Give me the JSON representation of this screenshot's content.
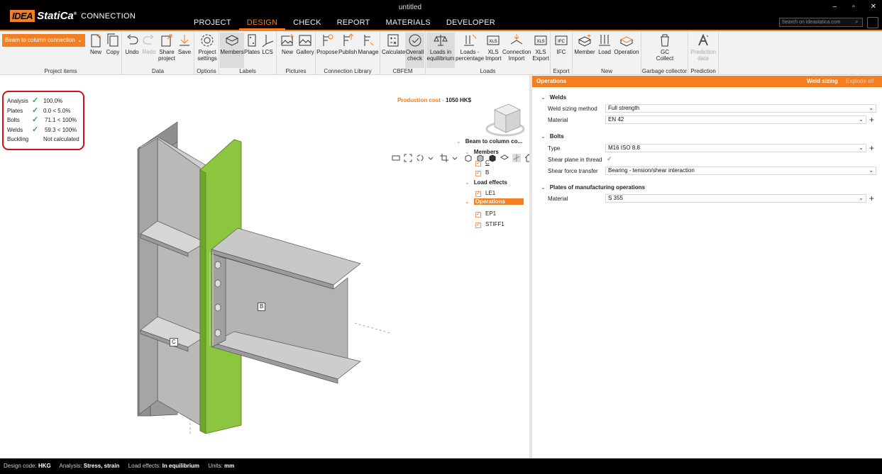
{
  "app": {
    "logo_idea": "IDEA",
    "logo_statica": "StatiCa",
    "logo_reg": "®",
    "product": "CONNECTION",
    "window_title": "untitled",
    "controls": [
      "–",
      "▫",
      "✕"
    ]
  },
  "menu": [
    "PROJECT",
    "DESIGN",
    "CHECK",
    "REPORT",
    "MATERIALS",
    "DEVELOPER"
  ],
  "search_placeholder": "Search on ideastatica.com",
  "ribbon": {
    "connection_dropdown": "Beam to column connection",
    "groups": {
      "project_items": "Project items",
      "data": "Data",
      "options": "Options",
      "labels": "Labels",
      "pictures": "Pictures",
      "library": "Connection Library",
      "cbfem": "CBFEM",
      "loads": "Loads",
      "export": "Export",
      "new": "New",
      "gc": "Garbage collector",
      "prediction": "Prediction"
    },
    "buttons": {
      "new": "New",
      "copy": "Copy",
      "undo": "Undo",
      "redo": "Redo",
      "share1": "Share",
      "share2": "project",
      "save": "Save",
      "proj1": "Project",
      "proj2": "settings",
      "members": "Members",
      "plates": "Plates",
      "lcs": "LCS",
      "pic_new": "New",
      "gallery": "Gallery",
      "propose": "Propose",
      "publish": "Publish",
      "manage": "Manage",
      "calculate": "Calculate",
      "overall1": "Overall",
      "overall2": "check",
      "loads_eq1": "Loads in",
      "loads_eq2": "equilibrium",
      "loads_pc1": "Loads -",
      "loads_pc2": "percentage",
      "xls_imp1": "XLS",
      "xls_imp2": "Import",
      "conn_imp1": "Connection",
      "conn_imp2": "Import",
      "xls_exp1": "XLS",
      "xls_exp2": "Export",
      "ifc": "IFC",
      "member": "Member",
      "load": "Load",
      "operation": "Operation",
      "gc1": "GC",
      "gc2": "Collect",
      "pred1": "Prediction",
      "pred2": "data"
    }
  },
  "results": [
    {
      "name": "Analysis",
      "value": "100.0%",
      "check": true
    },
    {
      "name": "Plates",
      "value": "0.0 < 5.0%",
      "check": true
    },
    {
      "name": "Bolts",
      "value": "71.1 < 100%",
      "check": true
    },
    {
      "name": "Welds",
      "value": "59.3 < 100%",
      "check": true
    },
    {
      "name": "Buckling",
      "value": "Not calculated",
      "check": false
    }
  ],
  "production_cost_label": "Production cost",
  "production_cost_value": "1050 HK$",
  "tree": {
    "root": "Beam to column co...",
    "members": "Members",
    "member_c": "C",
    "member_b": "B",
    "load_effects": "Load effects",
    "le1": "LE1",
    "operations": "Operations",
    "ep1": "EP1",
    "stiff1": "STIFF1"
  },
  "model_labels": {
    "beam": "B",
    "column": "C"
  },
  "panel": {
    "title": "Operations",
    "weld_sizing": "Weld sizing",
    "explode_all": "Explode all",
    "welds": "Welds",
    "weld_sizing_method_label": "Weld sizing method",
    "weld_sizing_method": "Full strength",
    "weld_material_label": "Material",
    "weld_material": "EN 42",
    "bolts": "Bolts",
    "bolt_type_label": "Type",
    "bolt_type": "M16 ISO 8.8",
    "shear_plane_label": "Shear plane in thread",
    "shear_transfer_label": "Shear force transfer",
    "shear_transfer": "Bearing - tension/shear interaction",
    "plates_section": "Plates of manufacturing operations",
    "plates_material_label": "Material",
    "plates_material": "S 355"
  },
  "status": {
    "design_code_label": "Design code:",
    "design_code": "HKG",
    "analysis_label": "Analysis:",
    "analysis": "Stress, strain",
    "load_effects_label": "Load effects:",
    "load_effects": "In equilibrium",
    "units_label": "Units:",
    "units": "mm"
  },
  "colors": {
    "accent": "#f57e20",
    "plate": "#8cc63f",
    "steel": "#b9b9b9",
    "highlight_border": "#d0101a"
  }
}
